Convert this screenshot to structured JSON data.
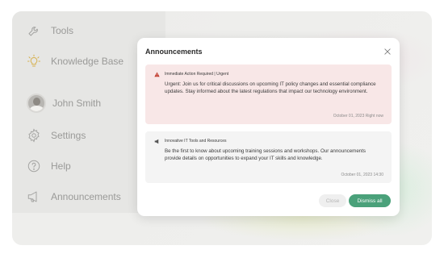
{
  "sidebar": {
    "items": [
      {
        "label": "Tools",
        "icon": "wrench-icon"
      },
      {
        "label": "Knowledge Base",
        "icon": "lightbulb-icon"
      },
      {
        "label": "John Smith",
        "icon": "avatar"
      },
      {
        "label": "Settings",
        "icon": "gear-icon"
      },
      {
        "label": "Help",
        "icon": "question-icon"
      },
      {
        "label": "Announcements",
        "icon": "megaphone-icon"
      }
    ]
  },
  "modal": {
    "title": "Announcements",
    "close_icon": "close-icon",
    "announcements": [
      {
        "type": "urgent",
        "icon": "warning-icon",
        "heading": "Immediate Action Required | Urgent",
        "body": "Urgent: Join us for critical discussions on upcoming IT policy changes and essential compliance updates. Stay informed about the latest regulations that impact our technology environment.",
        "meta": "October 01, 2023 Right now"
      },
      {
        "type": "info",
        "icon": "megaphone-icon",
        "heading": "Innovative IT Tools and Resources",
        "body": "Be the first to know about upcoming training sessions and workshops. Our announcements provide details on opportunities to expand your IT skills and knowledge.",
        "meta": "October 01, 2023 14:30"
      }
    ],
    "buttons": {
      "close_label": "Close",
      "dismiss_label": "Dismiss all"
    }
  },
  "colors": {
    "accent": "#4aa17a",
    "urgent_bg": "#f8e7e7",
    "urgent_icon": "#c0392b",
    "info_bg": "#f4f4f4"
  }
}
